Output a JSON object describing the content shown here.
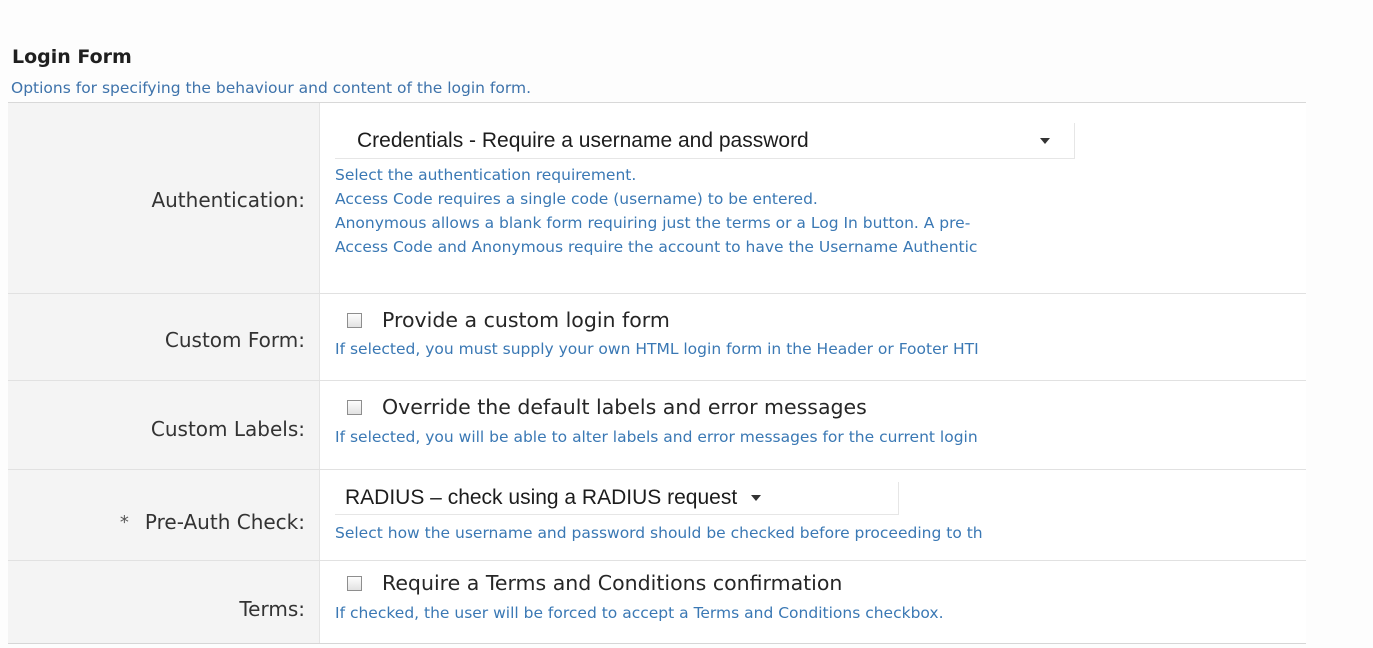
{
  "section": {
    "title": "Login Form",
    "description": "Options for specifying the behaviour and content of the login form."
  },
  "authentication": {
    "label": "Authentication:",
    "selected": "Credentials - Require a username and password",
    "help": [
      "Select the authentication requirement.",
      "Access Code requires a single code (username) to be entered.",
      "Anonymous allows a blank form requiring just the terms or a Log In button. A pre-",
      "Access Code and Anonymous require the account to have the Username Authentic"
    ]
  },
  "custom_form": {
    "label": "Custom Form:",
    "checkbox_label": "Provide a custom login form",
    "help": "If selected, you must supply your own HTML login form in the Header or Footer HTI"
  },
  "custom_labels": {
    "label": "Custom Labels:",
    "checkbox_label": "Override the default labels and error messages",
    "help": "If selected, you will be able to alter labels and error messages for the current login"
  },
  "pre_auth": {
    "required_marker": "*",
    "label": "Pre-Auth Check:",
    "selected": "RADIUS – check using a RADIUS request",
    "help": "Select how the username and password should be checked before proceeding to th"
  },
  "terms": {
    "label": "Terms:",
    "checkbox_label": "Require a Terms and Conditions confirmation",
    "help": "If checked, the user will be forced to accept a Terms and Conditions checkbox."
  },
  "colors": {
    "help_text": "#3a78b4",
    "label_background": "#f4f4f4"
  }
}
